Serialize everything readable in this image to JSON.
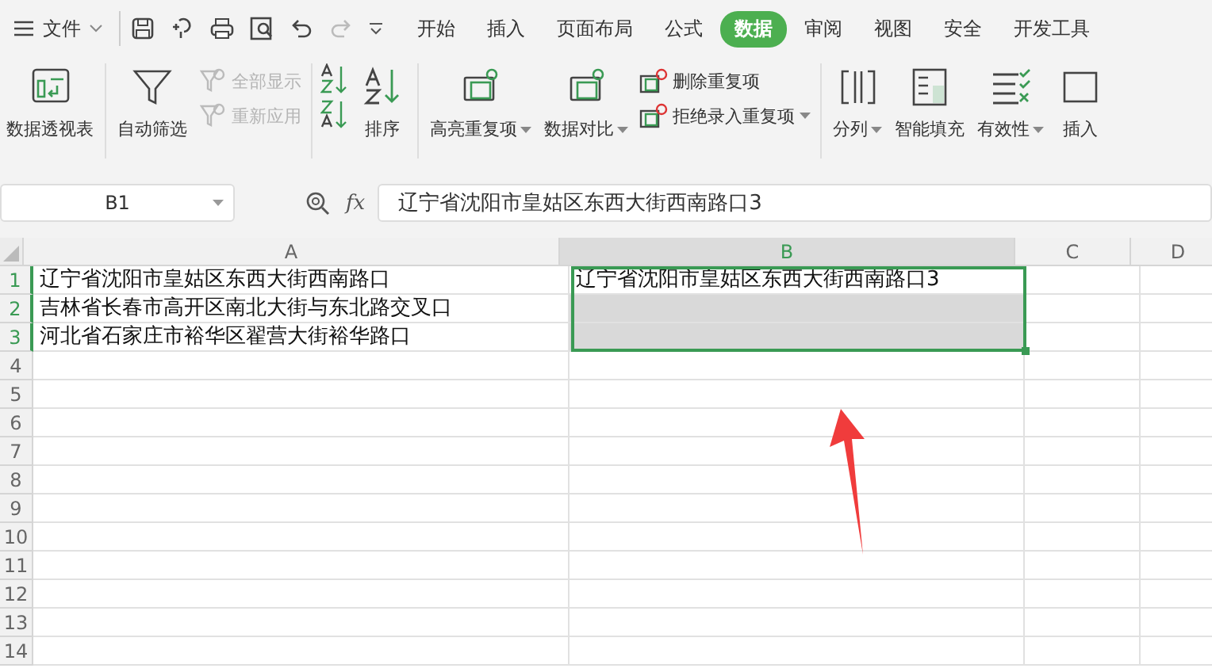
{
  "menu": {
    "label": "文件"
  },
  "tabs": [
    {
      "label": "开始",
      "selected": false
    },
    {
      "label": "插入",
      "selected": false
    },
    {
      "label": "页面布局",
      "selected": false
    },
    {
      "label": "公式",
      "selected": false
    },
    {
      "label": "数据",
      "selected": true
    },
    {
      "label": "审阅",
      "selected": false
    },
    {
      "label": "视图",
      "selected": false
    },
    {
      "label": "安全",
      "selected": false
    },
    {
      "label": "开发工具",
      "selected": false
    }
  ],
  "ribbon": [
    {
      "kind": "large",
      "label": "数据透视表",
      "dropdown": false
    },
    {
      "kind": "large",
      "label": "自动筛选",
      "dropdown": false
    },
    {
      "kind": "pair",
      "items": [
        {
          "label": "全部显示",
          "disabled": true,
          "dropdown": false
        },
        {
          "label": "重新应用",
          "disabled": true,
          "dropdown": false
        }
      ]
    },
    {
      "kind": "sort"
    },
    {
      "kind": "large",
      "label": "排序",
      "dropdown": false
    },
    {
      "kind": "large",
      "label": "高亮重复项",
      "dropdown": true
    },
    {
      "kind": "large",
      "label": "数据对比",
      "dropdown": true
    },
    {
      "kind": "pair",
      "items": [
        {
          "label": "删除重复项",
          "disabled": false,
          "dropdown": false
        },
        {
          "label": "拒绝录入重复项",
          "disabled": false,
          "dropdown": true
        }
      ]
    },
    {
      "kind": "large",
      "label": "分列",
      "dropdown": true
    },
    {
      "kind": "large",
      "label": "智能填充",
      "dropdown": false
    },
    {
      "kind": "large",
      "label": "有效性",
      "dropdown": true
    },
    {
      "kind": "large",
      "label": "插入",
      "dropdown": false
    }
  ],
  "name_box": {
    "value": "B1"
  },
  "formula_bar": {
    "label": "fx",
    "value": "辽宁省沈阳市皇姑区东西大街西南路口3"
  },
  "columns": [
    {
      "label": "A",
      "selected": false
    },
    {
      "label": "B",
      "selected": true
    },
    {
      "label": "C",
      "selected": false
    },
    {
      "label": "D",
      "selected": false
    }
  ],
  "rows": [
    {
      "number": "1",
      "selected": true,
      "cells": [
        "辽宁省沈阳市皇姑区东西大街西南路口",
        "辽宁省沈阳市皇姑区东西大街西南路口3"
      ]
    },
    {
      "number": "2",
      "selected": true,
      "cells": [
        "吉林省长春市高开区南北大街与东北路交叉口",
        ""
      ]
    },
    {
      "number": "3",
      "selected": true,
      "cells": [
        "河北省石家庄市裕华区翟营大街裕华路口",
        ""
      ]
    },
    {
      "number": "4",
      "selected": false,
      "cells": []
    },
    {
      "number": "5",
      "selected": false,
      "cells": []
    },
    {
      "number": "6",
      "selected": false,
      "cells": []
    },
    {
      "number": "7",
      "selected": false,
      "cells": []
    },
    {
      "number": "8",
      "selected": false,
      "cells": []
    },
    {
      "number": "9",
      "selected": false,
      "cells": []
    },
    {
      "number": "10",
      "selected": false,
      "cells": []
    },
    {
      "number": "11",
      "selected": false,
      "cells": []
    },
    {
      "number": "12",
      "selected": false,
      "cells": []
    },
    {
      "number": "13",
      "selected": false,
      "cells": []
    },
    {
      "number": "14",
      "selected": false,
      "cells": []
    }
  ]
}
